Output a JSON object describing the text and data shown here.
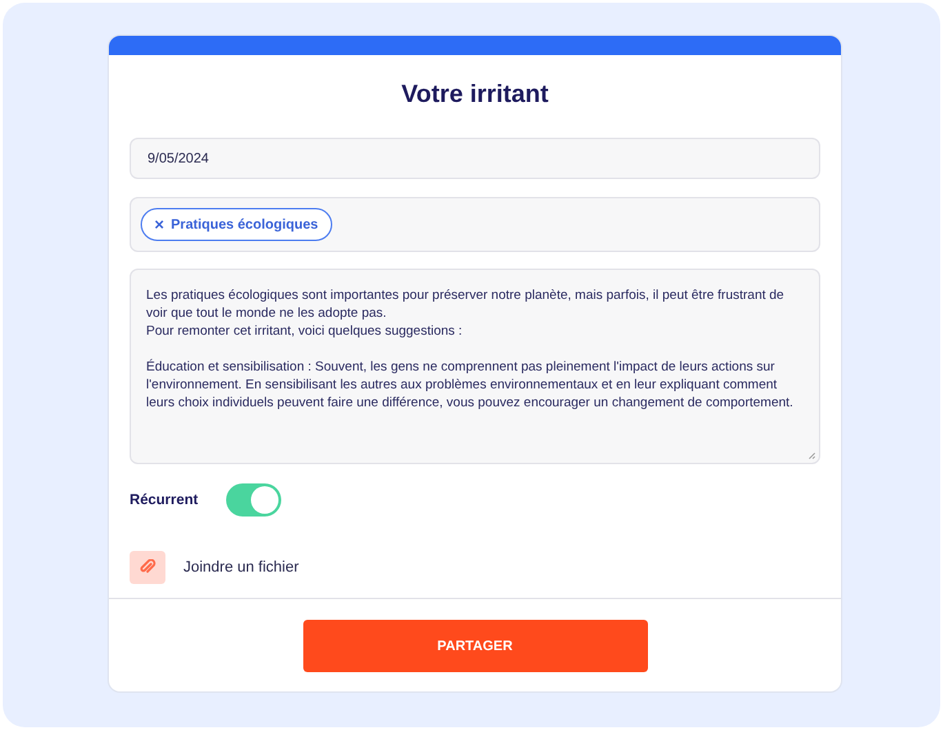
{
  "title": "Votre irritant",
  "date_field": {
    "value": "9/05/2024"
  },
  "tags": [
    {
      "label": "Pratiques écologiques",
      "remove_icon": "×"
    }
  ],
  "description": {
    "value": "Les pratiques écologiques sont importantes pour préserver notre planète, mais parfois, il peut être frustrant de voir que tout le monde ne les adopte pas.\nPour remonter cet irritant, voici quelques suggestions :\n\nÉducation et sensibilisation : Souvent, les gens ne comprennent pas pleinement l'impact de leurs actions sur l'environnement. En sensibilisant les autres aux problèmes environnementaux et en leur expliquant comment leurs choix individuels peuvent faire une différence, vous pouvez encourager un changement de comportement."
  },
  "recurrent": {
    "label": "Récurrent",
    "on": true
  },
  "attachment": {
    "label": "Joindre un fichier"
  },
  "submit_button": "PARTAGER"
}
